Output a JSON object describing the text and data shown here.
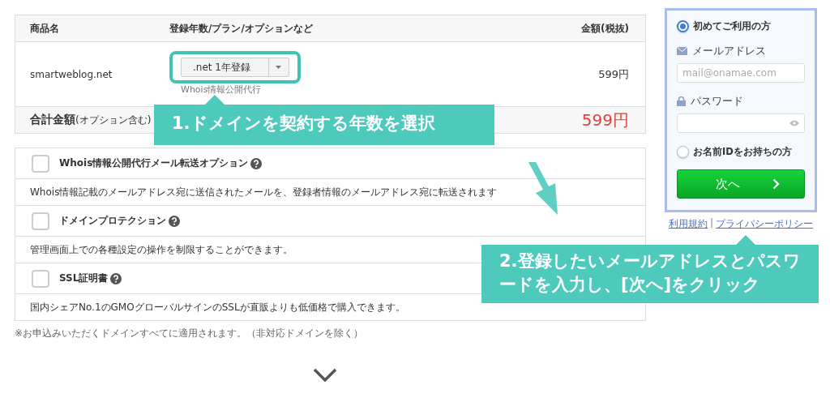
{
  "product_table": {
    "columns": [
      "商品名",
      "登録年数/プラン/オプションなど",
      "金額(税抜)"
    ],
    "row": {
      "product": "smartweblog.net",
      "plan_select": ".net 1年登録",
      "plan_note": "Whois情報公開代行",
      "price": "599円"
    },
    "total": {
      "label": "合計金額",
      "note": "(オプション含む)",
      "price": "599円"
    }
  },
  "options": [
    {
      "title": "Whois情報公開代行メール転送オプション",
      "checked": false,
      "description": "Whois情報記載のメールアドレス宛に送信されたメールを、登録者情報のメールアドレス宛に転送されます"
    },
    {
      "title": "ドメインプロテクション",
      "checked": false,
      "description": "管理画面上での各種設定の操作を制限することができます。"
    },
    {
      "title": "SSL証明書",
      "checked": false,
      "description": "国内シェアNo.1のGMOグローバルサインのSSLが直販よりも低価格で購入できます。"
    }
  ],
  "footnote": "※お申込みいただくドメインすべてに適用されます。（非対応ドメインを除く）",
  "login_panel": {
    "new_user": {
      "label": "初めてご利用の方",
      "selected": true
    },
    "email_label": "メールアドレス",
    "email_placeholder": "mail@onamae.com",
    "password_label": "パスワード",
    "member": {
      "label": "お名前IDをお持ちの方",
      "selected": false
    },
    "next_button": "次へ",
    "links": [
      "利用規約",
      "|",
      "プライバシーポリシー"
    ]
  },
  "callouts": [
    {
      "text": "1.ドメインを契約する年数を選択"
    },
    {
      "text": "2.登録したいメールアドレスとパスワードを入力し、[次へ]をクリック"
    }
  ]
}
